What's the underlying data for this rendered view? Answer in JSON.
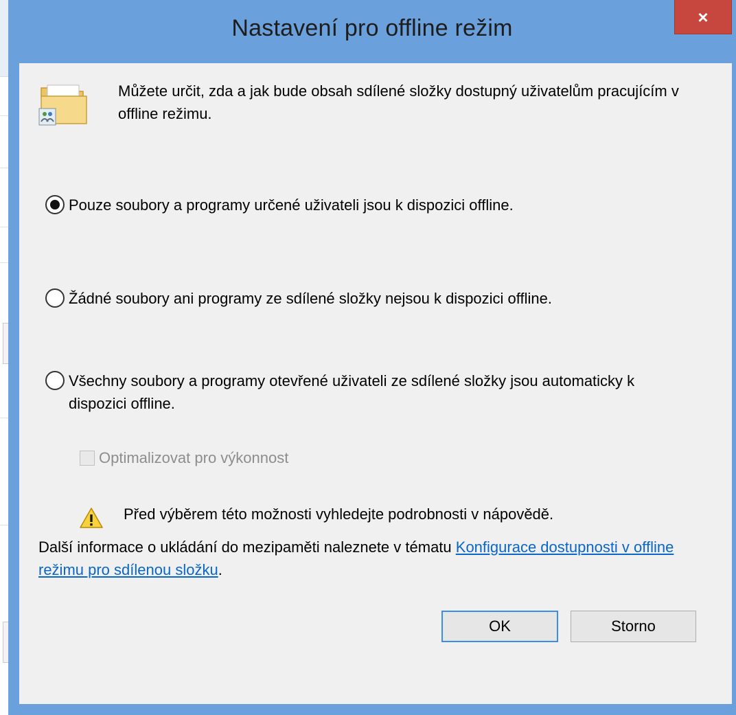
{
  "window": {
    "title": "Nastavení pro offline režim",
    "close_label": "×"
  },
  "intro": {
    "icon": "shared-folder-icon",
    "text": "Můžete určit, zda a jak bude obsah sdílené složky dostupný uživatelům pracujícím v offline režimu."
  },
  "options": [
    {
      "label": "Pouze soubory a programy určené uživateli jsou k dispozici offline.",
      "selected": true
    },
    {
      "label": "Žádné soubory ani programy ze sdílené složky nejsou k dispozici offline.",
      "selected": false
    },
    {
      "label": "Všechny soubory a programy otevřené uživateli ze sdílené složky jsou automaticky k dispozici offline.",
      "selected": false
    }
  ],
  "optimize": {
    "label": "Optimalizovat pro výkonnost",
    "checked": false,
    "enabled": false
  },
  "warning": {
    "icon": "warning-icon",
    "text": "Před výběrem této možnosti vyhledejte podrobnosti v nápovědě."
  },
  "info": {
    "prefix": "Další informace o ukládání do mezipaměti naleznete v tématu ",
    "link": "Konfigurace dostupnosti v offline režimu pro sdílenou složku",
    "suffix": "."
  },
  "buttons": {
    "ok": "OK",
    "cancel": "Storno"
  },
  "colors": {
    "title_bar": "#6aa0dc",
    "close_button": "#c7463e",
    "link": "#0a67c7",
    "default_button_border": "#3a8ee6"
  }
}
